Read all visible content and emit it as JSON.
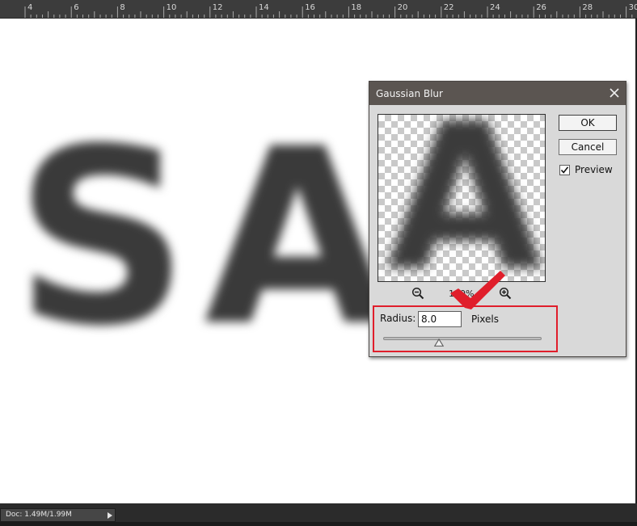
{
  "ruler": {
    "labels": [
      "4",
      "6",
      "8",
      "10",
      "12",
      "14",
      "16",
      "18",
      "20",
      "22",
      "24",
      "26",
      "28",
      "30"
    ]
  },
  "canvas": {
    "text": "SA"
  },
  "dialog": {
    "title": "Gaussian Blur",
    "ok_label": "OK",
    "cancel_label": "Cancel",
    "preview_label": "Preview",
    "preview_checked": true,
    "preview_letter": "A",
    "zoom_text": "100%",
    "radius_label": "Radius:",
    "radius_value": "8.0",
    "radius_unit": "Pixels",
    "radius_slider_fraction": 0.35,
    "icons": [
      "close-icon",
      "zoom-out-icon",
      "zoom-in-icon",
      "checkbox-check-icon",
      "slider-thumb-icon",
      "red-checkmark-annotation-icon"
    ]
  },
  "annotation": {
    "highlight_color": "#e01e2b",
    "checkmark_color": "#e01e2b"
  },
  "status": {
    "doc_text": "Doc: 1.49M/1.99M"
  }
}
